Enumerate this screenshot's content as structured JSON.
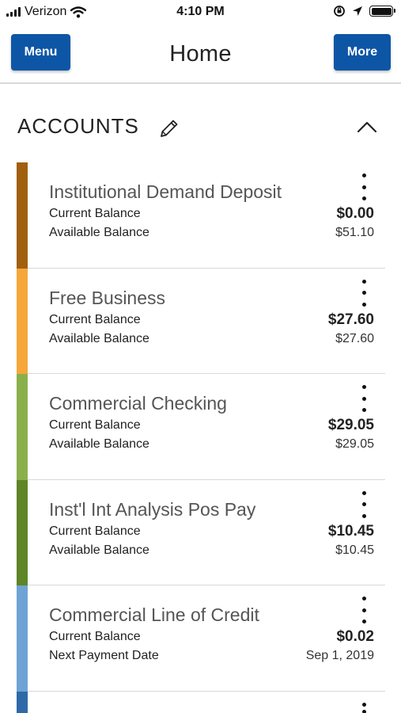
{
  "status_bar": {
    "carrier": "Verizon",
    "time": "4:10 PM"
  },
  "header": {
    "menu_label": "Menu",
    "title": "Home",
    "more_label": "More",
    "button_color": "#0d56a6"
  },
  "section": {
    "title": "ACCOUNTS",
    "edit_icon": "pencil-icon",
    "collapse_icon": "chevron-up-icon"
  },
  "accounts": [
    {
      "name": "Institutional Demand Deposit",
      "label1": "Current Balance",
      "value1": "$0.00",
      "label2": "Available Balance",
      "value2": "$51.10",
      "color": "#a0600e"
    },
    {
      "name": "Free Business",
      "label1": "Current Balance",
      "value1": "$27.60",
      "label2": "Available Balance",
      "value2": "$27.60",
      "color": "#f5a73a"
    },
    {
      "name": "Commercial Checking",
      "label1": "Current Balance",
      "value1": "$29.05",
      "label2": "Available Balance",
      "value2": "$29.05",
      "color": "#8ab04c"
    },
    {
      "name": "Inst'l Int Analysis Pos Pay",
      "label1": "Current Balance",
      "value1": "$10.45",
      "label2": "Available Balance",
      "value2": "$10.45",
      "color": "#5e8526"
    },
    {
      "name": "Commercial Line of Credit",
      "label1": "Current Balance",
      "value1": "$0.02",
      "label2": "Next Payment Date",
      "value2": "Sep 1, 2019",
      "color": "#6fa3d6"
    }
  ],
  "partial_account_color": "#2f6aa8"
}
